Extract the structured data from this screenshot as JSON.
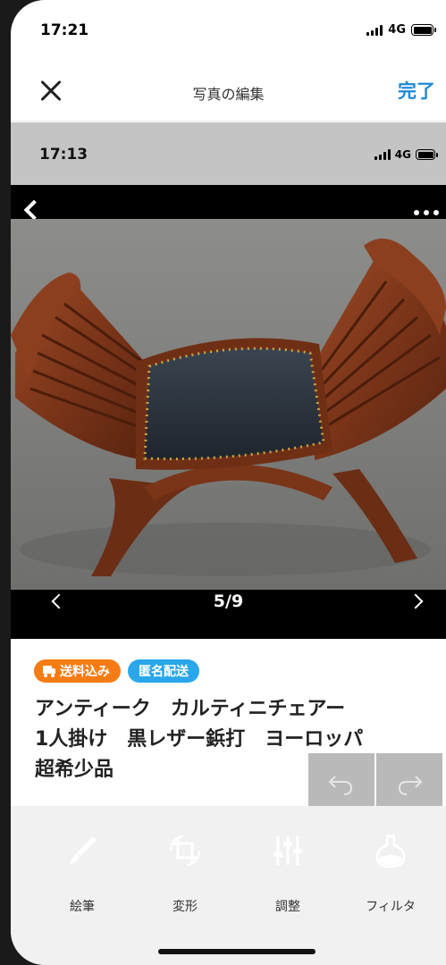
{
  "status_bar": {
    "time": "17:21",
    "network": "4G"
  },
  "header": {
    "title": "写真の編集",
    "done_label": "完了"
  },
  "photo": {
    "inner_status": {
      "time": "17:13",
      "network": "4G"
    },
    "pager": "5/9"
  },
  "listing": {
    "badges": [
      {
        "label": "送料込み",
        "color": "#f57c14",
        "icon": "truck-icon"
      },
      {
        "label": "匿名配送",
        "color": "#2aa7ea"
      }
    ],
    "title_lines": [
      "アンティーク　カルティニチェアー",
      "1人掛け　黒レザー鋲打　ヨーロッパ",
      "超希少品"
    ]
  },
  "edit_actions": {
    "undo_icon": "undo-icon",
    "redo_icon": "redo-icon"
  },
  "toolbar": {
    "items": [
      {
        "label": "絵筆",
        "icon": "brush-icon"
      },
      {
        "label": "変形",
        "icon": "crop-rotate-icon"
      },
      {
        "label": "調整",
        "icon": "sliders-icon"
      },
      {
        "label": "フィルタ",
        "icon": "flask-icon"
      }
    ]
  },
  "colors": {
    "accent": "#1c8ad9",
    "badge_orange": "#f57c14",
    "badge_blue": "#2aa7ea"
  }
}
